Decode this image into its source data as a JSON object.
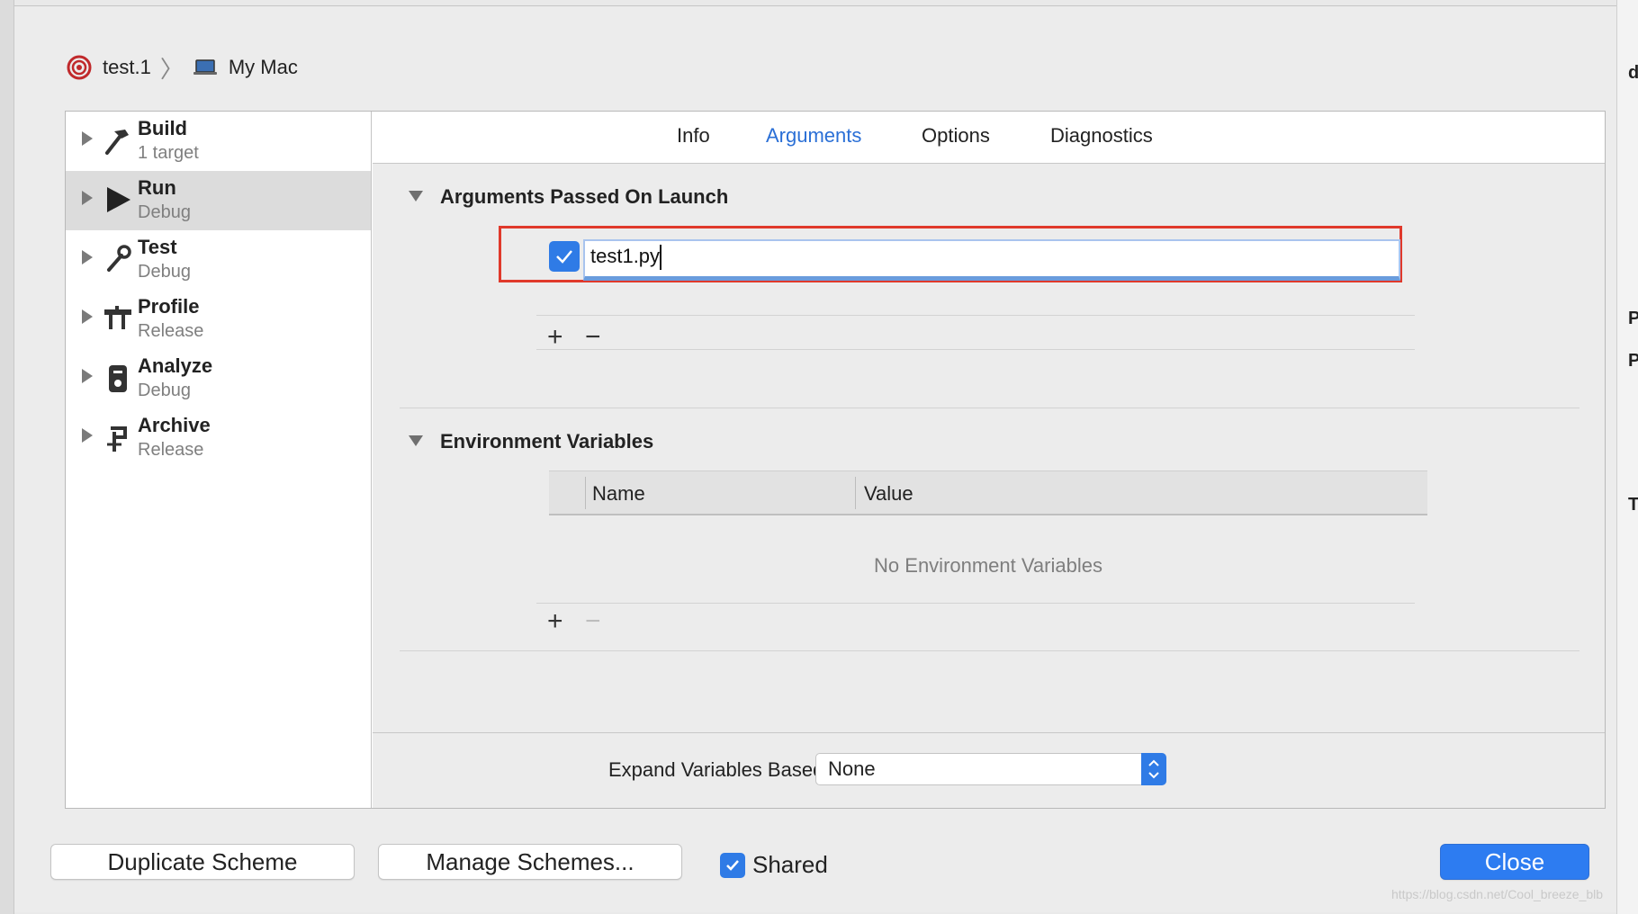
{
  "breadcrumb": {
    "scheme": "test.1",
    "destination": "My Mac"
  },
  "sidebar": {
    "items": [
      {
        "name": "Build",
        "sub": "1 target",
        "selected": false,
        "icon": "hammer-icon"
      },
      {
        "name": "Run",
        "sub": "Debug",
        "selected": true,
        "icon": "play-icon"
      },
      {
        "name": "Test",
        "sub": "Debug",
        "selected": false,
        "icon": "wrench-icon"
      },
      {
        "name": "Profile",
        "sub": "Release",
        "selected": false,
        "icon": "gauge-icon"
      },
      {
        "name": "Analyze",
        "sub": "Debug",
        "selected": false,
        "icon": "analyze-icon"
      },
      {
        "name": "Archive",
        "sub": "Release",
        "selected": false,
        "icon": "archive-icon"
      }
    ]
  },
  "tabs": [
    {
      "label": "Info",
      "active": false
    },
    {
      "label": "Arguments",
      "active": true
    },
    {
      "label": "Options",
      "active": false
    },
    {
      "label": "Diagnostics",
      "active": false
    }
  ],
  "arguments": {
    "title": "Arguments Passed On Launch",
    "items": [
      {
        "enabled": true,
        "value": "test1.py"
      }
    ]
  },
  "environment": {
    "title": "Environment Variables",
    "columns": [
      "Name",
      "Value"
    ],
    "empty_text": "No Environment Variables"
  },
  "expand": {
    "label": "Expand Variables Based On",
    "selected": "None"
  },
  "footer": {
    "duplicate_label": "Duplicate Scheme",
    "manage_label": "Manage Schemes...",
    "shared_label": "Shared",
    "shared_checked": true,
    "close_label": "Close"
  },
  "watermark": "https://blog.csdn.net/Cool_breeze_blb",
  "backdrop_letters": [
    "d",
    "Pr",
    "P",
    "Te"
  ],
  "colors": {
    "accent": "#2f7be6",
    "highlight": "#e0392b",
    "tab_active": "#2a6fd6"
  }
}
